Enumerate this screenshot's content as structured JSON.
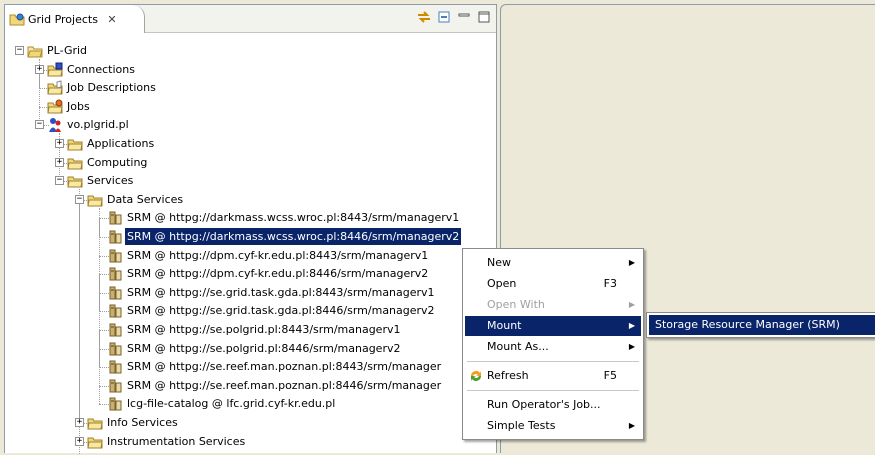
{
  "view": {
    "tab_title": "Grid Projects",
    "close_glyph": "✕",
    "tools": [
      "sync-icon",
      "collapse-all-icon",
      "minimize-icon",
      "maximize-icon"
    ]
  },
  "tree": [
    {
      "label": "PL-Grid",
      "icon": "project-icon",
      "expander": "−"
    },
    {
      "label": "Connections",
      "icon": "connections-folder-icon",
      "expander": "+"
    },
    {
      "label": "Job Descriptions",
      "icon": "job-descriptions-folder-icon",
      "expander": ""
    },
    {
      "label": "Jobs",
      "icon": "jobs-folder-icon",
      "expander": ""
    },
    {
      "label": "vo.plgrid.pl",
      "icon": "vo-icon",
      "expander": "−"
    },
    {
      "label": "Applications",
      "icon": "folder-icon",
      "expander": "+"
    },
    {
      "label": "Computing",
      "icon": "folder-icon",
      "expander": "+"
    },
    {
      "label": "Services",
      "icon": "folder-icon",
      "expander": "−"
    },
    {
      "label": "Data Services",
      "icon": "folder-icon",
      "expander": "−"
    },
    {
      "label": "SRM @ httpg://darkmass.wcss.wroc.pl:8443/srm/managerv1",
      "icon": "srm-service-icon",
      "expander": ""
    },
    {
      "label": "SRM @ httpg://darkmass.wcss.wroc.pl:8446/srm/managerv2",
      "icon": "srm-service-icon",
      "expander": ""
    },
    {
      "label": "SRM @ httpg://dpm.cyf-kr.edu.pl:8443/srm/managerv1",
      "icon": "srm-service-icon",
      "expander": ""
    },
    {
      "label": "SRM @ httpg://dpm.cyf-kr.edu.pl:8446/srm/managerv2",
      "icon": "srm-service-icon",
      "expander": ""
    },
    {
      "label": "SRM @ httpg://se.grid.task.gda.pl:8443/srm/managerv1",
      "icon": "srm-service-icon",
      "expander": ""
    },
    {
      "label": "SRM @ httpg://se.grid.task.gda.pl:8446/srm/managerv2",
      "icon": "srm-service-icon",
      "expander": ""
    },
    {
      "label": "SRM @ httpg://se.polgrid.pl:8443/srm/managerv1",
      "icon": "srm-service-icon",
      "expander": ""
    },
    {
      "label": "SRM @ httpg://se.polgrid.pl:8446/srm/managerv2",
      "icon": "srm-service-icon",
      "expander": ""
    },
    {
      "label": "SRM @ httpg://se.reef.man.poznan.pl:8443/srm/manager",
      "icon": "srm-service-icon",
      "expander": ""
    },
    {
      "label": "SRM @ httpg://se.reef.man.poznan.pl:8446/srm/manager",
      "icon": "srm-service-icon",
      "expander": ""
    },
    {
      "label": "lcg-file-catalog @ lfc.grid.cyf-kr.edu.pl",
      "icon": "srm-service-icon",
      "expander": ""
    },
    {
      "label": "Info Services",
      "icon": "folder-icon",
      "expander": "+"
    },
    {
      "label": "Instrumentation Services",
      "icon": "folder-icon",
      "expander": "+"
    }
  ],
  "selected_index": 10,
  "context_menu": {
    "items": [
      {
        "label": "New",
        "shortcut": "",
        "submenu": true,
        "disabled": false,
        "highlighted": false,
        "icon": ""
      },
      {
        "label": "Open",
        "shortcut": "F3",
        "submenu": false,
        "disabled": false,
        "highlighted": false,
        "icon": ""
      },
      {
        "label": "Open With",
        "shortcut": "",
        "submenu": true,
        "disabled": true,
        "highlighted": false,
        "icon": ""
      },
      {
        "label": "Mount",
        "shortcut": "",
        "submenu": true,
        "disabled": false,
        "highlighted": true,
        "icon": ""
      },
      {
        "label": "Mount As...",
        "shortcut": "",
        "submenu": true,
        "disabled": false,
        "highlighted": false,
        "icon": ""
      },
      {
        "label": "Refresh",
        "shortcut": "F5",
        "submenu": false,
        "disabled": false,
        "highlighted": false,
        "icon": "refresh-icon"
      },
      {
        "label": "Run Operator's Job...",
        "shortcut": "",
        "submenu": false,
        "disabled": false,
        "highlighted": false,
        "icon": ""
      },
      {
        "label": "Simple Tests",
        "shortcut": "",
        "submenu": true,
        "disabled": false,
        "highlighted": false,
        "icon": ""
      }
    ],
    "submenu_open": {
      "parent": "Mount",
      "items": [
        "Storage Resource Manager (SRM)"
      ]
    }
  },
  "colors": {
    "selection": "#0a246a",
    "folder": "#f0d878",
    "srm": "#c8b070"
  }
}
